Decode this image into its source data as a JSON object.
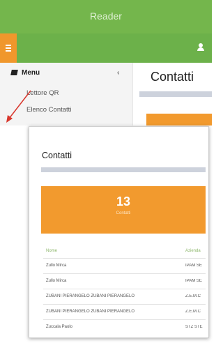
{
  "app": {
    "title": "Reader",
    "colors": {
      "primary": "#74b64c",
      "accent": "#f29a2e"
    }
  },
  "sidebar": {
    "menu_label": "Menu",
    "menu_icon": "book-icon",
    "collapse_icon": "chevron-left-icon",
    "items": [
      {
        "label": "Lettore QR"
      },
      {
        "label": "Elenco Contatti"
      }
    ]
  },
  "main": {
    "title": "Contatti"
  },
  "zoom": {
    "title": "Contatti",
    "stat": {
      "value": "13",
      "label": "Contatti"
    },
    "table": {
      "headers": [
        "Nome",
        "Azienda"
      ],
      "rows": [
        [
          "Zullo Mirca",
          "IPAM SE"
        ],
        [
          "Zullo Mirca",
          "IPAM SE"
        ],
        [
          "ZUBANI PIERANGELO ZUBANI PIERANGELO",
          "Z.E.M.C"
        ],
        [
          "ZUBANI PIERANGELO ZUBANI PIERANGELO",
          "Z.E.M.C"
        ],
        [
          "Zuccala Paolo",
          "STZ STE"
        ]
      ]
    }
  }
}
